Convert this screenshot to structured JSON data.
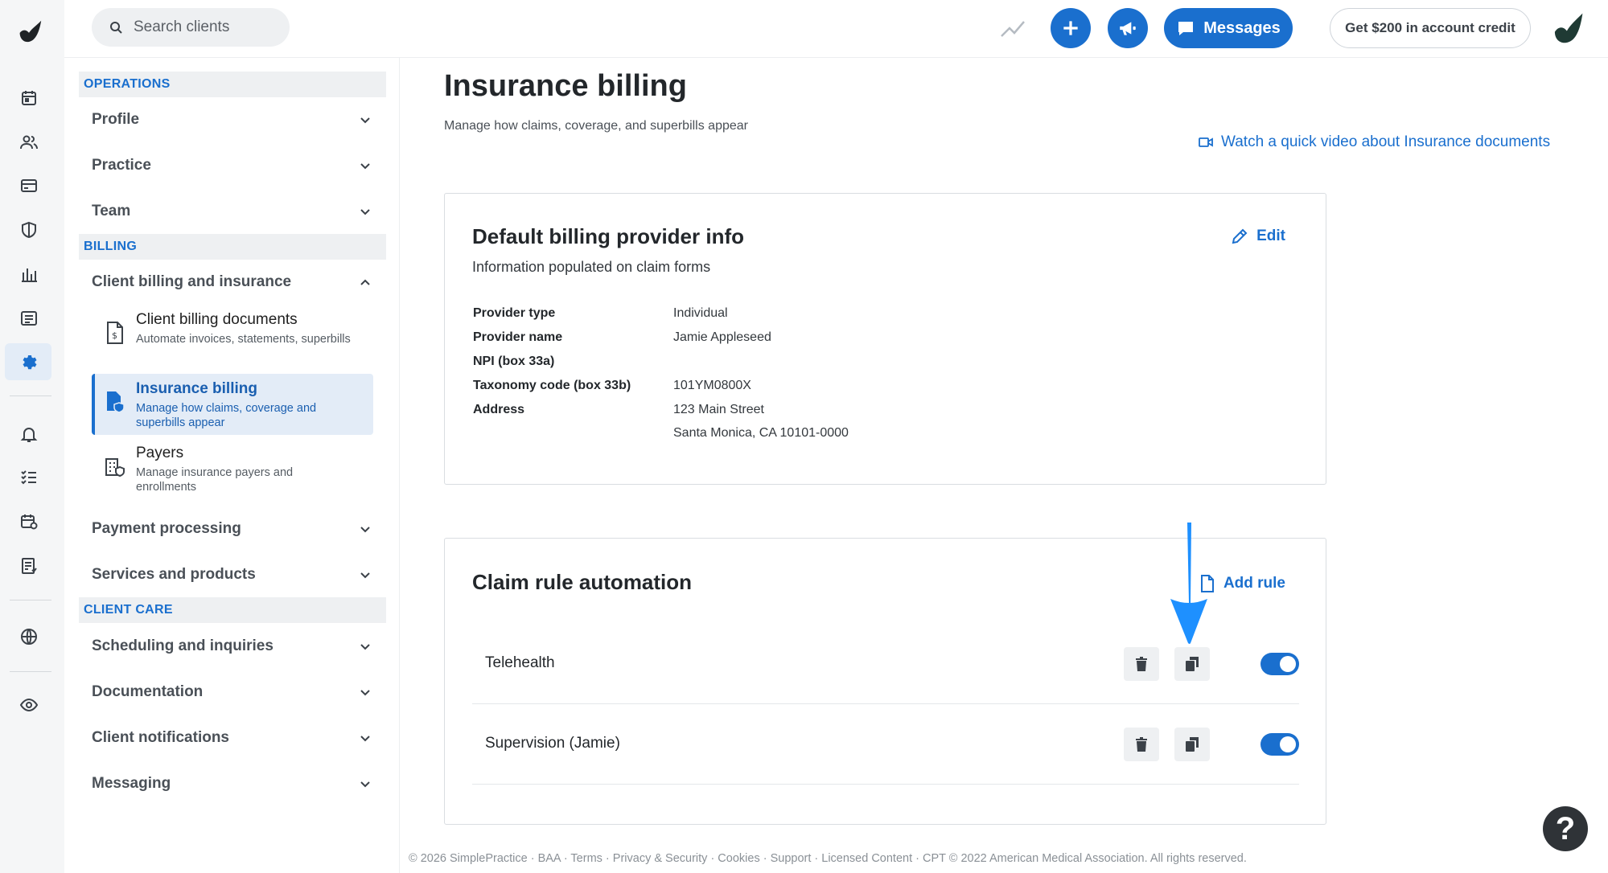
{
  "search": {
    "placeholder": "Search clients"
  },
  "topbar": {
    "messages_label": "Messages",
    "credit_label": "Get $200 in account credit"
  },
  "sidebar": {
    "operations_head": "OPERATIONS",
    "billing_head": "BILLING",
    "client_care_head": "CLIENT CARE",
    "profile": "Profile",
    "practice": "Practice",
    "team": "Team",
    "client_billing_insurance": "Client billing and insurance",
    "sub_items": [
      {
        "title": "Client billing documents",
        "desc": "Automate invoices, statements, superbills"
      },
      {
        "title": "Insurance billing",
        "desc": "Manage how claims, coverage and superbills appear"
      },
      {
        "title": "Payers",
        "desc": "Manage insurance payers and enrollments"
      }
    ],
    "payment_processing": "Payment processing",
    "services_products": "Services and products",
    "scheduling_inquiries": "Scheduling and inquiries",
    "documentation": "Documentation",
    "client_notifications": "Client notifications",
    "messaging": "Messaging"
  },
  "main": {
    "title": "Insurance billing",
    "subtitle": "Manage how claims, coverage, and superbills appear",
    "video_link": "Watch a quick video about Insurance documents"
  },
  "provider_card": {
    "title": "Default billing provider info",
    "subtitle": "Information populated on claim forms",
    "edit_label": "Edit",
    "rows": [
      {
        "label": "Provider type",
        "value": "Individual"
      },
      {
        "label": "Provider name",
        "value": "Jamie Appleseed"
      },
      {
        "label": "NPI (box 33a)",
        "value": ""
      },
      {
        "label": "Taxonomy code (box 33b)",
        "value": "101YM0800X"
      },
      {
        "label": "Address",
        "value": "123 Main Street"
      },
      {
        "label": "",
        "value": "Santa Monica, CA 10101-0000"
      }
    ]
  },
  "claim_card": {
    "title": "Claim rule automation",
    "add_rule_label": "Add rule",
    "rules": [
      {
        "name": "Telehealth",
        "enabled": true
      },
      {
        "name": "Supervision (Jamie)",
        "enabled": true
      }
    ]
  },
  "footer": "© 2026 SimplePractice · BAA · Terms · Privacy & Security · Cookies · Support · Licensed Content · CPT © 2022 American Medical Association. All rights reserved.",
  "help_label": "?",
  "colors": {
    "accent": "#1a6fce",
    "active_bg": "#e3ecf7",
    "annotation_arrow": "#1e90ff"
  }
}
